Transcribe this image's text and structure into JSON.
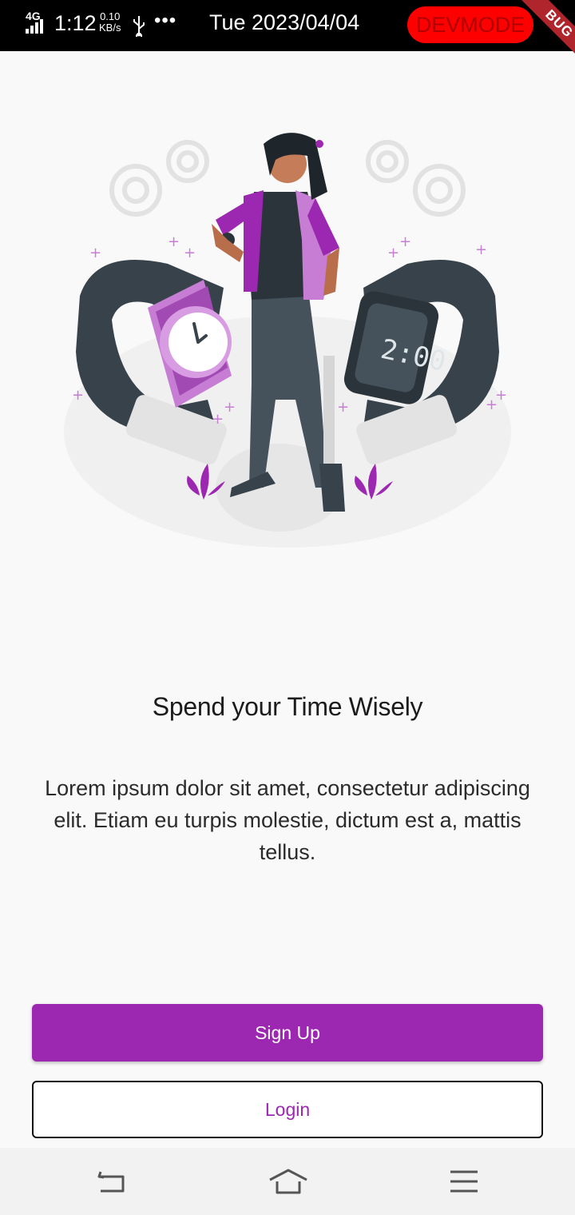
{
  "status_bar": {
    "network": "4G",
    "time": "1:12",
    "speed_value": "0.10",
    "speed_unit": "KB/s",
    "more": "•••",
    "date": "Tue 2023/04/04",
    "devmode_label": "DEVMODE",
    "debug_label": "BUG",
    "icons": [
      "signal-icon",
      "usb-icon"
    ]
  },
  "onboarding": {
    "title": "Spend your Time Wisely",
    "description": "Lorem ipsum dolor sit amet, consectetur adipiscing elit. Etiam eu turpis molestie, dictum est a, mattis tellus."
  },
  "buttons": {
    "signup_label": "Sign Up",
    "login_label": "Login"
  },
  "nav_bar": {
    "icons": [
      "back-icon",
      "home-icon",
      "menu-icon"
    ]
  },
  "colors": {
    "accent": "#9c27b0",
    "devmode": "#ff0000",
    "ribbon": "#b0242c"
  }
}
